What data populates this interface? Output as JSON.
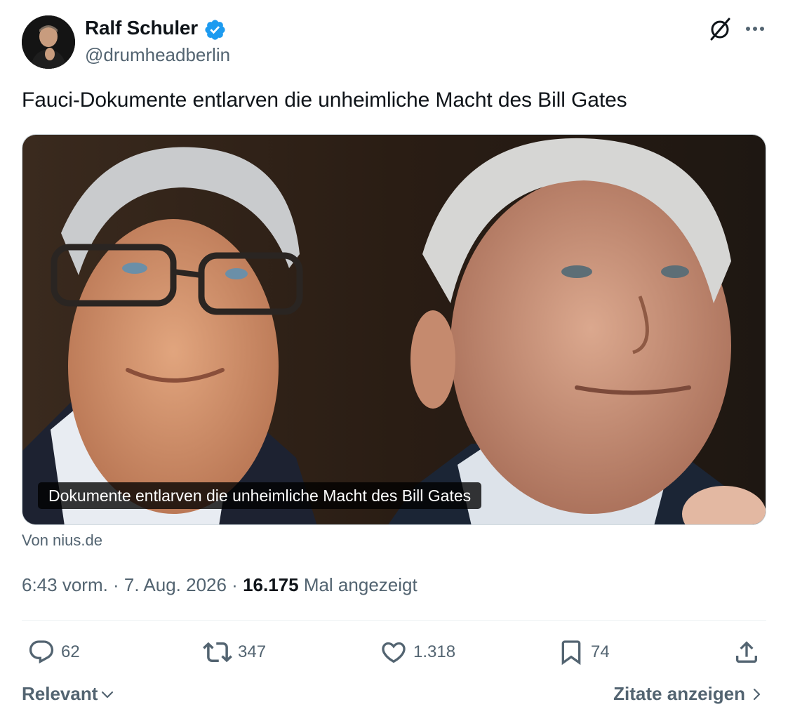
{
  "author": {
    "name": "Ralf Schuler",
    "handle": "@drumheadberlin",
    "verified_color": "#1d9bf0"
  },
  "header_icons": [
    "grok-icon",
    "more-icon"
  ],
  "tweet": {
    "text": "Fauci-Dokumente entlarven die unheimliche Macht des Bill Gates"
  },
  "card": {
    "caption": "Dokumente entlarven die unheimliche Macht des Bill Gates",
    "source": "Von nius.de"
  },
  "meta": {
    "time_date": "6:43 vorm. · 7. Aug. 2026 · ",
    "views": "16.175",
    "views_label": " Mal angezeigt"
  },
  "actions": {
    "replies": "62",
    "reposts": "347",
    "likes": "1.318",
    "bookmarks": "74"
  },
  "footer": {
    "sort_label": "Relevant",
    "quotes_label": "Zitate anzeigen"
  },
  "colors": {
    "text_primary": "#0f1419",
    "text_secondary": "#536471",
    "accent": "#1d9bf0",
    "divider": "#eff3f4"
  }
}
